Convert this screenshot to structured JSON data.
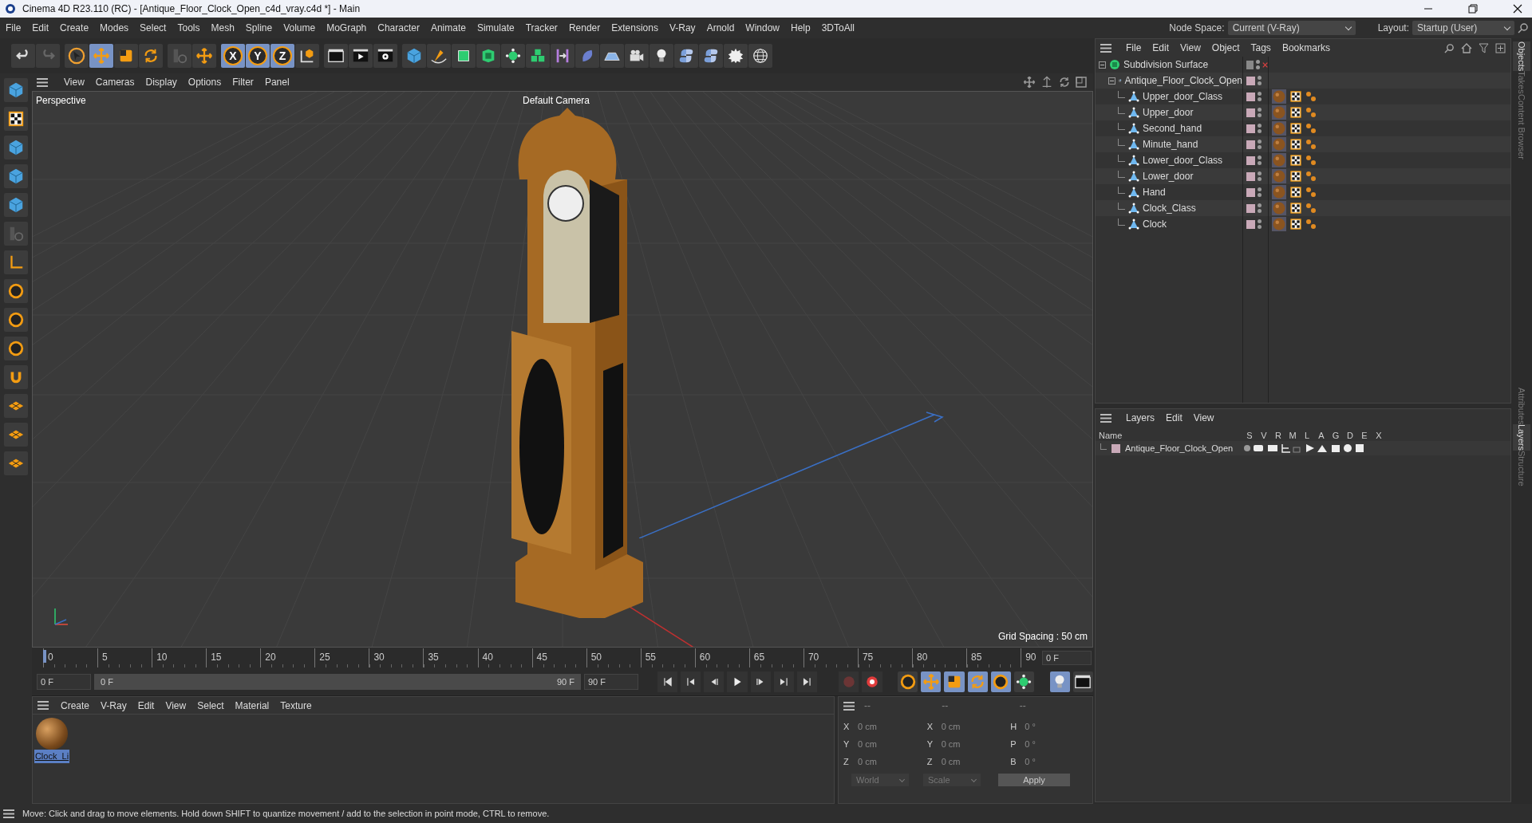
{
  "window": {
    "title": "Cinema 4D R23.110 (RC) - [Antique_Floor_Clock_Open_c4d_vray.c4d *] - Main"
  },
  "menu_bar": [
    "File",
    "Edit",
    "Create",
    "Modes",
    "Select",
    "Tools",
    "Mesh",
    "Spline",
    "Volume",
    "MoGraph",
    "Character",
    "Animate",
    "Simulate",
    "Tracker",
    "Render",
    "Extensions",
    "V-Ray",
    "Arnold",
    "Window",
    "Help",
    "3DToAll"
  ],
  "node_space": {
    "label": "Node Space:",
    "value": "Current (V-Ray)"
  },
  "layout": {
    "label": "Layout:",
    "value": "Startup (User)"
  },
  "axis_buttons": [
    "X",
    "Y",
    "Z"
  ],
  "viewport": {
    "menu": [
      "View",
      "Cameras",
      "Display",
      "Options",
      "Filter",
      "Panel"
    ],
    "view_name": "Perspective",
    "camera": "Default Camera",
    "grid_spacing": "Grid Spacing : 50 cm"
  },
  "timeline": {
    "ticks": [
      "0",
      "5",
      "10",
      "15",
      "20",
      "25",
      "30",
      "35",
      "40",
      "45",
      "50",
      "55",
      "60",
      "65",
      "70",
      "75",
      "80",
      "85",
      "90"
    ],
    "current_frame": "0 F",
    "start": "0 F",
    "range_start": "0 F",
    "range_end": "90 F",
    "end": "90 F"
  },
  "materials": {
    "menu": [
      "Create",
      "V-Ray",
      "Edit",
      "View",
      "Select",
      "Material",
      "Texture"
    ],
    "items": [
      {
        "name": "Clock_Li",
        "selected": true
      }
    ]
  },
  "coordinates": {
    "headers": [
      "--",
      "--",
      "--"
    ],
    "columns": [
      [
        {
          "label": "X",
          "value": "0 cm"
        },
        {
          "label": "Y",
          "value": "0 cm"
        },
        {
          "label": "Z",
          "value": "0 cm"
        }
      ],
      [
        {
          "label": "X",
          "value": "0 cm"
        },
        {
          "label": "Y",
          "value": "0 cm"
        },
        {
          "label": "Z",
          "value": "0 cm"
        }
      ],
      [
        {
          "label": "H",
          "value": "0 °"
        },
        {
          "label": "P",
          "value": "0 °"
        },
        {
          "label": "B",
          "value": "0 °"
        }
      ]
    ],
    "dropdowns": [
      "World",
      "Scale"
    ],
    "apply": "Apply"
  },
  "objects_panel": {
    "menu": [
      "File",
      "Edit",
      "View",
      "Object",
      "Tags",
      "Bookmarks"
    ],
    "tree": [
      {
        "name": "Subdivision Surface",
        "kind": "generator",
        "expanded": true,
        "children": [
          {
            "name": "Antique_Floor_Clock_Open",
            "kind": "null",
            "expanded": true,
            "children": [
              {
                "name": "Upper_door_Class",
                "kind": "polygon"
              },
              {
                "name": "Upper_door",
                "kind": "polygon"
              },
              {
                "name": "Second_hand",
                "kind": "polygon"
              },
              {
                "name": "Minute_hand",
                "kind": "polygon"
              },
              {
                "name": "Lower_door_Class",
                "kind": "polygon"
              },
              {
                "name": "Lower_door",
                "kind": "polygon"
              },
              {
                "name": "Hand",
                "kind": "polygon"
              },
              {
                "name": "Clock_Class",
                "kind": "polygon"
              },
              {
                "name": "Clock",
                "kind": "polygon"
              }
            ]
          }
        ]
      }
    ]
  },
  "layers_panel": {
    "menu": [
      "Layers",
      "Edit",
      "View"
    ],
    "columns": [
      "Name",
      "S",
      "V",
      "R",
      "M",
      "L",
      "A",
      "G",
      "D",
      "E",
      "X"
    ],
    "rows": [
      {
        "name": "Antique_Floor_Clock_Open",
        "color": "#c9a9b8"
      }
    ]
  },
  "side_tabs_top": [
    {
      "label": "Objects",
      "selected": true
    },
    {
      "label": "Takes",
      "selected": false
    },
    {
      "label": "Content Browser",
      "selected": false
    }
  ],
  "side_tabs_bottom": [
    {
      "label": "Attributes",
      "selected": false
    },
    {
      "label": "Layers",
      "selected": true
    },
    {
      "label": "Structure",
      "selected": false
    }
  ],
  "status_bar": "Move: Click and drag to move elements. Hold down SHIFT to quantize movement / add to the selection in point mode, CTRL to remove."
}
